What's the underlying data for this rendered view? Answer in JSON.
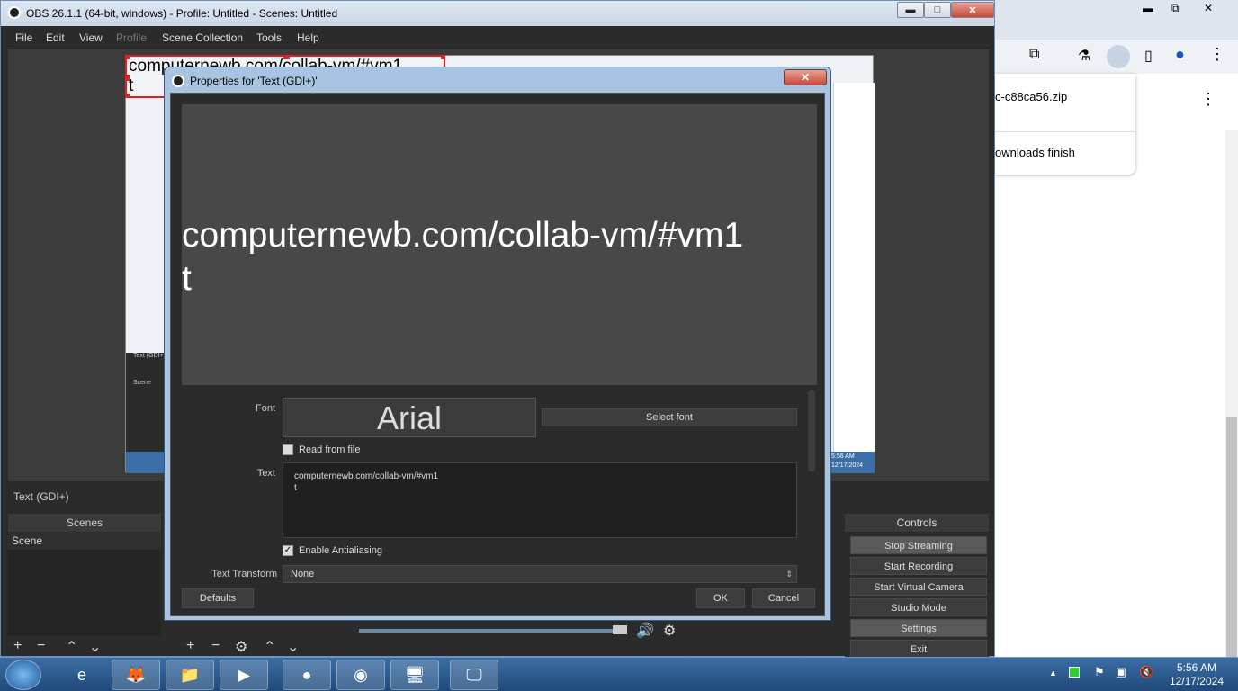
{
  "obs": {
    "title": "OBS 26.1.1 (64-bit, windows) - Profile: Untitled - Scenes: Untitled",
    "min": "▬",
    "max": "□",
    "close": "✕",
    "menu": [
      "File",
      "Edit",
      "View",
      "Profile",
      "Scene Collection",
      "Tools",
      "Help"
    ],
    "preview_text_line1": "computernewb.com/collab-vm/#vm1",
    "preview_text_line2": "t",
    "source_label": "Text (GDI+)",
    "scenes_header": "Scenes",
    "scene_item": "Scene",
    "mini_source": "Text (GDI+)",
    "mini_scene": "Scene",
    "mini_time": "5:56 AM",
    "mini_date": "12/17/2024",
    "controls_header": "Controls",
    "controls": [
      "Stop Streaming",
      "Start Recording",
      "Start Virtual Camera",
      "Studio Mode",
      "Settings",
      "Exit"
    ]
  },
  "dialog": {
    "title": "Properties for 'Text (GDI+)'",
    "close": "✕",
    "preview_line1": "computernewb.com/collab-vm/#vm1",
    "preview_line2": "t",
    "font_label": "Font",
    "font_value": "Arial",
    "select_font": "Select font",
    "read_from_file": "Read from file",
    "text_label": "Text",
    "text_line1": "computernewb.com/collab-vm/#vm1",
    "text_line2": "t",
    "antialias_label": "Enable Antialiasing",
    "antialias_checked": true,
    "transform_label": "Text Transform",
    "transform_value": "None",
    "defaults": "Defaults",
    "ok": "OK",
    "cancel": "Cancel"
  },
  "chrome": {
    "min": "▬",
    "max": "⧉",
    "close": "✕",
    "download_file": "c-c88ca56.zip",
    "download_status": "ownloads finish"
  },
  "taskbar": {
    "time": "5:56 AM",
    "date": "12/17/2024"
  }
}
